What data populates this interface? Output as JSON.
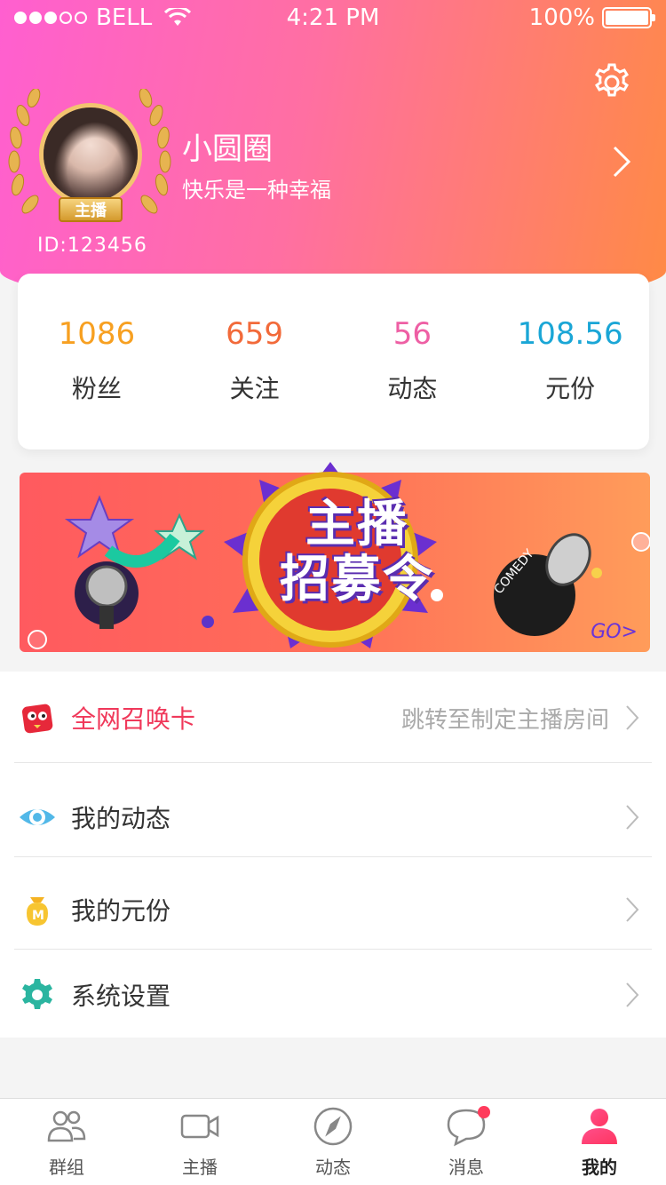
{
  "status_bar": {
    "carrier": "BELL",
    "time": "4:21 PM",
    "battery": "100%"
  },
  "profile": {
    "name": "小圆圈",
    "motto": "快乐是一种幸福",
    "id": "ID:123456",
    "role_badge": "主播"
  },
  "stats": [
    {
      "value": "1086",
      "label": "粉丝",
      "color": "#f7a021"
    },
    {
      "value": "659",
      "label": "关注",
      "color": "#f26a3a"
    },
    {
      "value": "56",
      "label": "动态",
      "color": "#ee5fa4"
    },
    {
      "value": "108.56",
      "label": "元份",
      "color": "#1aa6d6"
    }
  ],
  "banner": {
    "title_line1": "主播",
    "title_line2": "招募令",
    "go": "GO>"
  },
  "menu": [
    {
      "label": "全网召唤卡",
      "hint": "跳转至制定主播房间",
      "icon": "red-envelope-icon"
    },
    {
      "label": "我的动态",
      "hint": "",
      "icon": "eye-icon"
    },
    {
      "label": "我的元份",
      "hint": "",
      "icon": "money-bag-icon"
    },
    {
      "label": "系统设置",
      "hint": "",
      "icon": "settings-gear-icon"
    }
  ],
  "tabs": [
    {
      "label": "群组",
      "icon": "group-icon"
    },
    {
      "label": "主播",
      "icon": "video-camera-icon"
    },
    {
      "label": "动态",
      "icon": "compass-icon"
    },
    {
      "label": "消息",
      "icon": "chat-bubble-icon"
    },
    {
      "label": "我的",
      "icon": "profile-icon"
    }
  ],
  "colors": {
    "gradient_start": "#ff5fd0",
    "gradient_end": "#ff8a45",
    "accent_red": "#f0385a"
  }
}
